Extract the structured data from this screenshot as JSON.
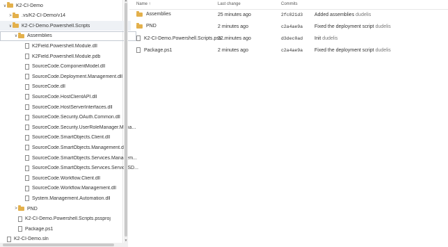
{
  "tree": {
    "items": [
      {
        "label": "K2-CI-Demo",
        "type": "folder",
        "expanded": true
      },
      {
        "label": ".vs/K2-CI-Demo/v14",
        "type": "folder",
        "expanded": false
      },
      {
        "label": "K2-CI-Demo.Powershell.Scripts",
        "type": "folder",
        "expanded": true
      },
      {
        "label": "Assemblies",
        "type": "folder",
        "expanded": true
      },
      {
        "label": "K2Field.Powershell.Module.dll",
        "type": "file"
      },
      {
        "label": "K2Field.Powershell.Module.pdb",
        "type": "file"
      },
      {
        "label": "SourceCode.ComponentModel.dll",
        "type": "file"
      },
      {
        "label": "SourceCode.Deployment.Management.dll",
        "type": "file"
      },
      {
        "label": "SourceCode.dll",
        "type": "file"
      },
      {
        "label": "SourceCode.HostClientAPI.dll",
        "type": "file"
      },
      {
        "label": "SourceCode.HostServerInterfaces.dll",
        "type": "file"
      },
      {
        "label": "SourceCode.Security.OAuth.Common.dll",
        "type": "file"
      },
      {
        "label": "SourceCode.Security.UserRoleManager.Mana...",
        "type": "file"
      },
      {
        "label": "SourceCode.SmartObjects.Client.dll",
        "type": "file"
      },
      {
        "label": "SourceCode.SmartObjects.Management.dll",
        "type": "file"
      },
      {
        "label": "SourceCode.SmartObjects.Services.Managem...",
        "type": "file"
      },
      {
        "label": "SourceCode.SmartObjects.Services.ServiceSD...",
        "type": "file"
      },
      {
        "label": "SourceCode.Workflow.Client.dll",
        "type": "file"
      },
      {
        "label": "SourceCode.Workflow.Management.dll",
        "type": "file"
      },
      {
        "label": "System.Management.Automation.dll",
        "type": "file"
      },
      {
        "label": "PND",
        "type": "folder",
        "expanded": false
      },
      {
        "label": "K2-CI-Demo.Powershell.Scripts.pssproj",
        "type": "file"
      },
      {
        "label": "Package.ps1",
        "type": "file"
      },
      {
        "label": "K2-CI-Demo.sln",
        "type": "file"
      }
    ]
  },
  "table": {
    "headers": {
      "name": "Name ↑",
      "last_change": "Last change",
      "commits": "Commits"
    },
    "rows": [
      {
        "name": "Assemblies",
        "type": "folder",
        "last_change": "25 minutes ago",
        "commit": "2fc821d3",
        "message": "Added assemblies",
        "author": "dudelis"
      },
      {
        "name": "PND",
        "type": "folder",
        "last_change": "2 minutes ago",
        "commit": "c2a4ae9a",
        "message": "Fixed the deployment script",
        "author": "dudelis"
      },
      {
        "name": "K2-CI-Demo.Powershell.Scripts.pss...",
        "type": "file",
        "last_change": "32 minutes ago",
        "commit": "d3dec0ad",
        "message": "Init",
        "author": "dudelis"
      },
      {
        "name": "Package.ps1",
        "type": "file",
        "last_change": "2 minutes ago",
        "commit": "c2a4ae9a",
        "message": "Fixed the deployment script",
        "author": "dudelis"
      }
    ]
  }
}
